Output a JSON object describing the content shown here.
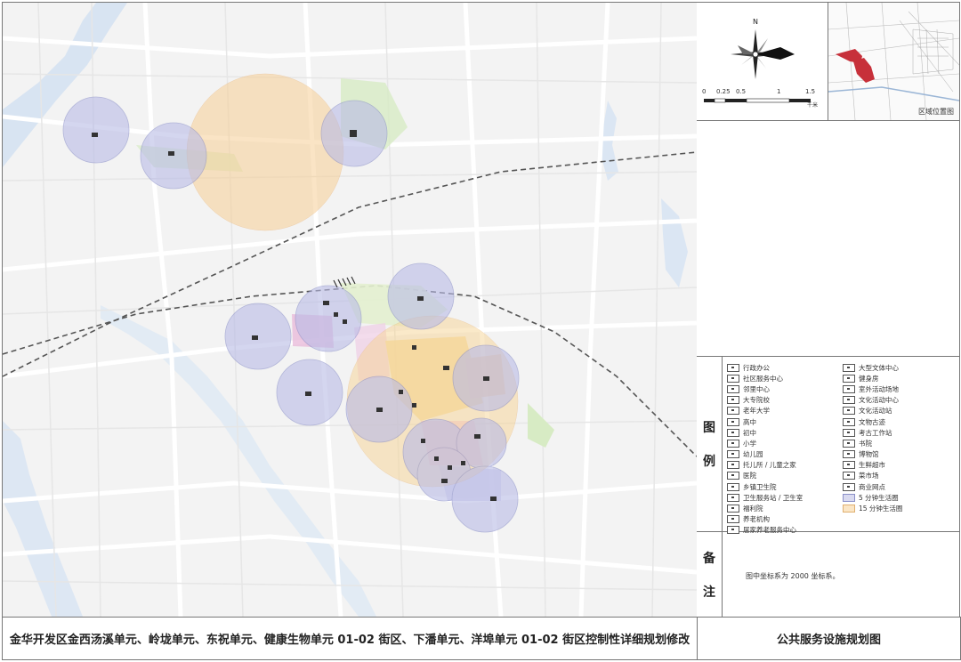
{
  "north": {
    "label": "N"
  },
  "scale": {
    "ticks": [
      "0",
      "0.25",
      "0.5",
      "1",
      "1.5"
    ],
    "unit": "千米"
  },
  "location": {
    "label": "区域位置图"
  },
  "legend": {
    "title_chars": [
      "图",
      "例"
    ],
    "left_items": [
      {
        "label": "行政办公",
        "kind": "icon"
      },
      {
        "label": "社区服务中心",
        "kind": "icon"
      },
      {
        "label": "邻里中心",
        "kind": "icon"
      },
      {
        "label": "大专院校",
        "kind": "icon"
      },
      {
        "label": "老年大学",
        "kind": "icon"
      },
      {
        "label": "高中",
        "kind": "icon"
      },
      {
        "label": "初中",
        "kind": "icon"
      },
      {
        "label": "小学",
        "kind": "icon"
      },
      {
        "label": "幼儿园",
        "kind": "icon"
      },
      {
        "label": "托儿所 / 儿童之家",
        "kind": "icon"
      },
      {
        "label": "医院",
        "kind": "icon"
      },
      {
        "label": "乡镇卫生院",
        "kind": "icon"
      },
      {
        "label": "卫生服务站 / 卫生室",
        "kind": "icon"
      },
      {
        "label": "福利院",
        "kind": "icon"
      },
      {
        "label": "养老机构",
        "kind": "icon"
      },
      {
        "label": "居家养老服务中心",
        "kind": "icon"
      }
    ],
    "right_items": [
      {
        "label": "大型文体中心",
        "kind": "icon"
      },
      {
        "label": "健身房",
        "kind": "icon"
      },
      {
        "label": "室外活动场地",
        "kind": "icon"
      },
      {
        "label": "文化活动中心",
        "kind": "icon"
      },
      {
        "label": "文化活动站",
        "kind": "icon"
      },
      {
        "label": "文物古迹",
        "kind": "icon"
      },
      {
        "label": "考古工作站",
        "kind": "icon"
      },
      {
        "label": "书院",
        "kind": "icon"
      },
      {
        "label": "博物馆",
        "kind": "icon"
      },
      {
        "label": "生鲜超市",
        "kind": "icon"
      },
      {
        "label": "菜市场",
        "kind": "icon"
      },
      {
        "label": "商业网点",
        "kind": "icon"
      },
      {
        "label": "5 分钟生活圈",
        "kind": "ring5"
      },
      {
        "label": "15 分钟生活圈",
        "kind": "ring15"
      }
    ]
  },
  "notes": {
    "title_chars": [
      "备",
      "注"
    ],
    "text": "图中坐标系为 2000 坐标系。"
  },
  "footer": {
    "project_title": "金华开发区金西汤溪单元、岭垅单元、东祝单元、健康生物单元 01-02 街区、下潘单元、洋埠单元 01-02 街区控制性详细规划修改",
    "drawing_title": "公共服务设施规划图"
  },
  "colors": {
    "ring5_fill": "#b9bbe6",
    "ring5_stroke": "#8a8fc8",
    "ring15_fill": "#f7cf96",
    "water": "#d8e4f2",
    "green": "#d7ebc4",
    "road": "#ffffff"
  }
}
